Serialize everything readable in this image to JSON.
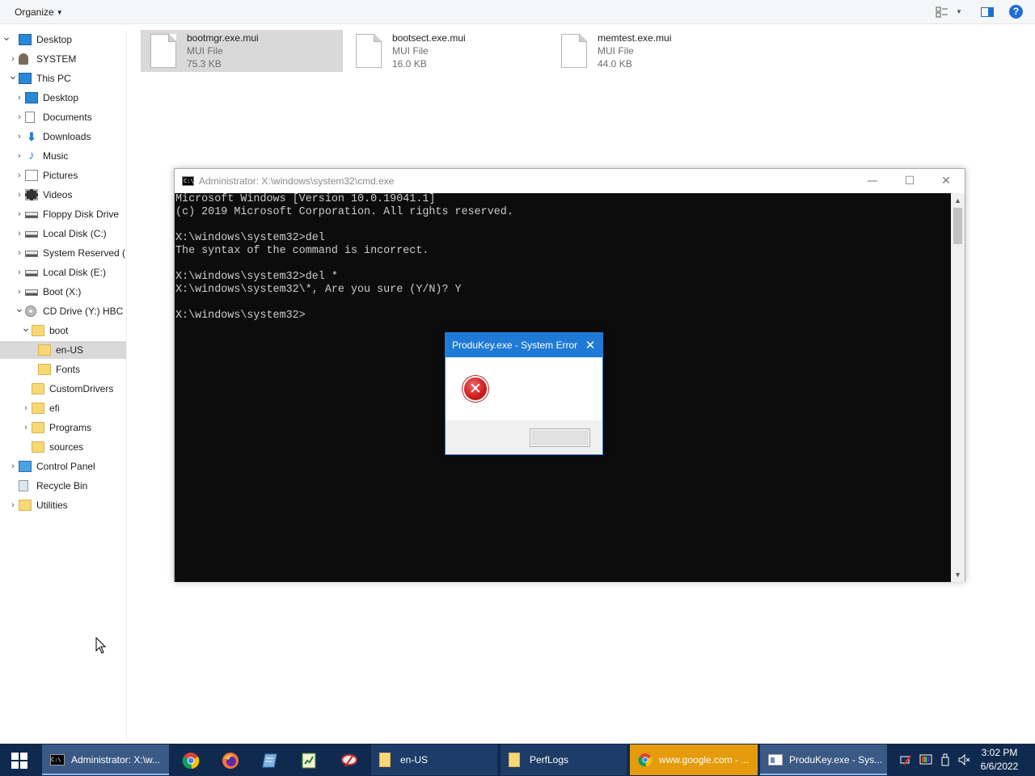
{
  "toolbar": {
    "organize_label": "Organize"
  },
  "nav": {
    "items": [
      {
        "label": "Desktop",
        "name": "nav-item-desktop-root",
        "icon": "desktop-icon"
      },
      {
        "label": "SYSTEM",
        "name": "nav-item-system",
        "icon": "user-icon"
      },
      {
        "label": "This PC",
        "name": "nav-item-this-pc",
        "icon": "computer-icon"
      },
      {
        "label": "Desktop",
        "name": "nav-item-desktop",
        "icon": "desktop-icon"
      },
      {
        "label": "Documents",
        "name": "nav-item-documents",
        "icon": "documents-icon"
      },
      {
        "label": "Downloads",
        "name": "nav-item-downloads",
        "icon": "downloads-icon"
      },
      {
        "label": "Music",
        "name": "nav-item-music",
        "icon": "music-icon"
      },
      {
        "label": "Pictures",
        "name": "nav-item-pictures",
        "icon": "pictures-icon"
      },
      {
        "label": "Videos",
        "name": "nav-item-videos",
        "icon": "videos-icon"
      },
      {
        "label": "Floppy Disk Drive",
        "name": "nav-item-floppy",
        "icon": "drive-icon"
      },
      {
        "label": "Local Disk (C:)",
        "name": "nav-item-local-disk-c",
        "icon": "drive-icon"
      },
      {
        "label": "System Reserved (",
        "name": "nav-item-system-reserved",
        "icon": "drive-icon"
      },
      {
        "label": "Local Disk (E:)",
        "name": "nav-item-local-disk-e",
        "icon": "drive-icon"
      },
      {
        "label": "Boot (X:)",
        "name": "nav-item-boot-x",
        "icon": "drive-icon"
      },
      {
        "label": "CD Drive (Y:) HBC",
        "name": "nav-item-cd-drive",
        "icon": "cd-drive-icon"
      },
      {
        "label": "boot",
        "name": "nav-item-boot",
        "icon": "folder-icon"
      },
      {
        "label": "en-US",
        "name": "nav-item-en-us",
        "icon": "folder-icon"
      },
      {
        "label": "Fonts",
        "name": "nav-item-fonts",
        "icon": "folder-icon"
      },
      {
        "label": "CustomDrivers",
        "name": "nav-item-customdrivers",
        "icon": "folder-icon"
      },
      {
        "label": "efi",
        "name": "nav-item-efi",
        "icon": "folder-icon"
      },
      {
        "label": "Programs",
        "name": "nav-item-programs",
        "icon": "folder-icon"
      },
      {
        "label": "sources",
        "name": "nav-item-sources",
        "icon": "folder-icon"
      },
      {
        "label": "Control Panel",
        "name": "nav-item-control-panel",
        "icon": "control-panel-icon"
      },
      {
        "label": "Recycle Bin",
        "name": "nav-item-recycle-bin",
        "icon": "recycle-bin-icon"
      },
      {
        "label": "Utilities",
        "name": "nav-item-utilities",
        "icon": "folder-icon"
      }
    ],
    "selected": "en-US"
  },
  "files": [
    {
      "name": "bootmgr.exe.mui",
      "type": "MUI File",
      "size": "75.3 KB"
    },
    {
      "name": "bootsect.exe.mui",
      "type": "MUI File",
      "size": "16.0 KB"
    },
    {
      "name": "memtest.exe.mui",
      "type": "MUI File",
      "size": "44.0 KB"
    }
  ],
  "cmd": {
    "title": "Administrator: X:\\windows\\system32\\cmd.exe",
    "lines": [
      "Microsoft Windows [Version 10.0.19041.1]",
      "(c) 2019 Microsoft Corporation. All rights reserved.",
      "",
      "X:\\windows\\system32>del",
      "The syntax of the command is incorrect.",
      "",
      "X:\\windows\\system32>del *",
      "X:\\windows\\system32\\*, Are you sure (Y/N)? Y",
      "",
      "X:\\windows\\system32>"
    ]
  },
  "dialog": {
    "title": "ProduKey.exe - System Error",
    "icon": "error-icon",
    "ok_label": ""
  },
  "taskbar": {
    "tasks": [
      {
        "label": "Administrator: X:\\w...",
        "icon": "cmd-icon"
      },
      {
        "label": "en-US",
        "icon": "folder-icon"
      },
      {
        "label": "PerfLogs",
        "icon": "folder-icon"
      },
      {
        "label": "www.google.com - ...",
        "icon": "chrome-icon"
      },
      {
        "label": "ProduKey.exe - Sys...",
        "icon": "window-icon"
      }
    ],
    "pinned": [
      "chrome-icon",
      "firefox-icon",
      "notepad-icon",
      "editor-icon",
      "app-icon"
    ],
    "clock_time": "3:02 PM",
    "clock_date": "6/6/2022"
  },
  "colors": {
    "taskbar": "#102a4f",
    "dialog_title": "#1f7ad6",
    "console_bg": "#0c0c0c",
    "console_text": "#cccccc",
    "selection": "#d9d9d9",
    "flash_task": "#e59b0d"
  }
}
